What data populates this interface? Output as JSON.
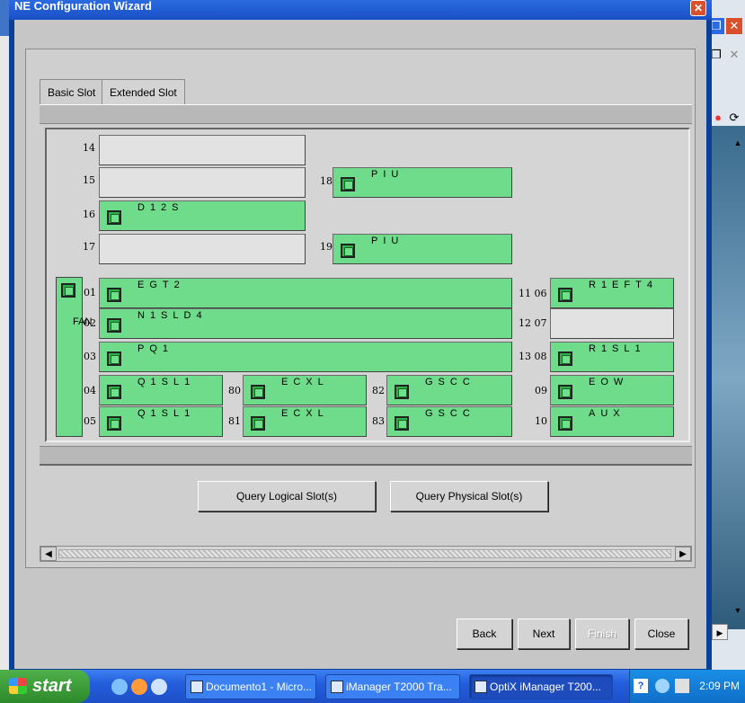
{
  "window": {
    "title": "NE Configuration Wizard"
  },
  "tabs": [
    {
      "label": "Basic Slot"
    },
    {
      "label": "Extended Slot"
    }
  ],
  "fan": {
    "label": "FAN"
  },
  "slots": {
    "s14": {
      "num": "14",
      "name": ""
    },
    "s15": {
      "num": "15",
      "name": ""
    },
    "s16": {
      "num": "16",
      "name": "D12S"
    },
    "s17": {
      "num": "17",
      "name": ""
    },
    "s18": {
      "num": "18",
      "name": "PIU"
    },
    "s19": {
      "num": "19",
      "name": "PIU"
    },
    "s01": {
      "num": "01",
      "name": "EGT2"
    },
    "s02": {
      "num": "02",
      "name": "N1SLD4"
    },
    "s03": {
      "num": "03",
      "name": "PQ1"
    },
    "s04": {
      "num": "04",
      "name": "Q1SL1"
    },
    "s05": {
      "num": "05",
      "name": "Q1SL1"
    },
    "s80": {
      "num": "80",
      "name": "ECXL"
    },
    "s81": {
      "num": "81",
      "name": "ECXL"
    },
    "s82": {
      "num": "82",
      "name": "GSCC"
    },
    "s83": {
      "num": "83",
      "name": "GSCC"
    },
    "s06": {
      "num": "11 06",
      "name": "R1EFT4"
    },
    "s07": {
      "num": "12 07",
      "name": ""
    },
    "s08": {
      "num": "13 08",
      "name": "R1SL1"
    },
    "s09": {
      "num": "09",
      "name": "EOW"
    },
    "s10": {
      "num": "10",
      "name": "AUX"
    }
  },
  "buttons": {
    "query_logical": "Query Logical Slot(s)",
    "query_physical": "Query Physical Slot(s)",
    "back": "Back",
    "next": "Next",
    "finish": "Finish",
    "close": "Close"
  },
  "taskbar": {
    "start": "start",
    "tasks": [
      {
        "label": "Documento1 - Micro..."
      },
      {
        "label": "iManager T2000 Tra..."
      },
      {
        "label": "OptiX iManager T200..."
      }
    ],
    "clock": "2:09 PM"
  },
  "colors": {
    "board_green": "#6edc8b",
    "empty_slot": "#e2e2e2"
  }
}
